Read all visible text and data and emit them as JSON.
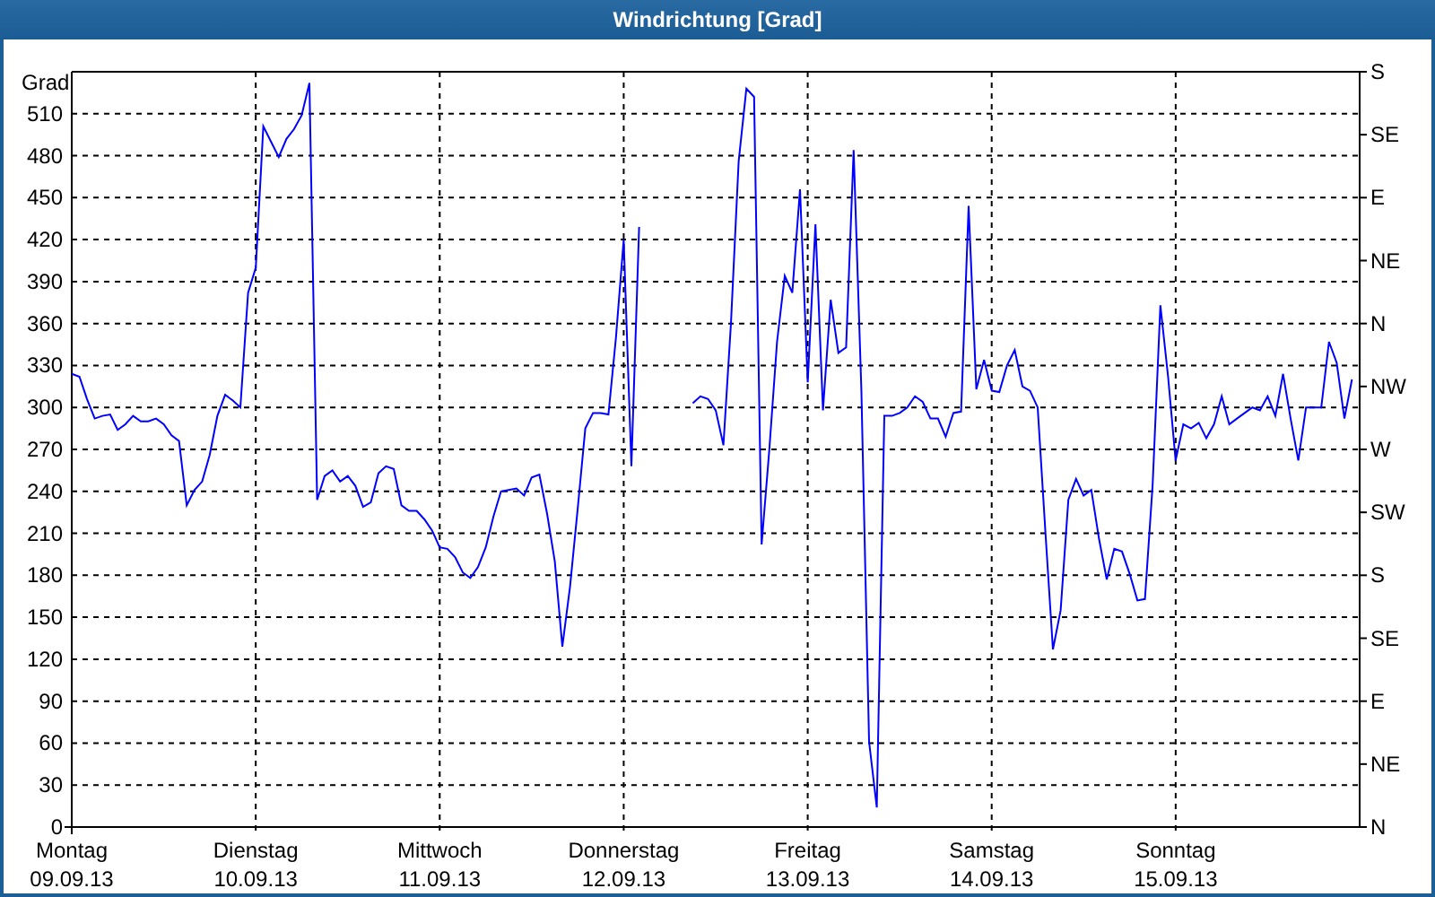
{
  "window": {
    "title": "Windrichtung [Grad]"
  },
  "chart": {
    "chart_data": {
      "type": "line",
      "grid": true,
      "ylabel": "Grad",
      "ylim": [
        0,
        540
      ],
      "yticks": [
        0,
        30,
        60,
        90,
        120,
        150,
        180,
        210,
        240,
        270,
        300,
        330,
        360,
        390,
        420,
        450,
        480,
        510
      ],
      "categories": [
        "09.09.13",
        null,
        null,
        null,
        null,
        null,
        null,
        null,
        null,
        null,
        null,
        null,
        null,
        null,
        null,
        null,
        null,
        null,
        null,
        null,
        null,
        null,
        null,
        null,
        "10.09.13",
        null,
        null,
        null,
        null,
        null,
        null,
        null,
        null,
        null,
        null,
        null,
        null,
        null,
        null,
        null,
        null,
        null,
        null,
        null,
        null,
        null,
        null,
        null,
        "11.09.13",
        null,
        null,
        null,
        null,
        null,
        null,
        null,
        null,
        null,
        null,
        null,
        null,
        null,
        null,
        null,
        null,
        null,
        null,
        null,
        null,
        null,
        null,
        null,
        "12.09.13",
        null,
        null,
        null,
        null,
        null,
        null,
        null,
        null,
        null,
        null,
        null,
        null,
        null,
        null,
        null,
        null,
        null,
        null,
        null,
        null,
        null,
        null,
        null,
        "13.09.13",
        null,
        null,
        null,
        null,
        null,
        null,
        null,
        null,
        null,
        null,
        null,
        null,
        null,
        null,
        null,
        null,
        null,
        null,
        null,
        null,
        null,
        null,
        null,
        "14.09.13",
        null,
        null,
        null,
        null,
        null,
        null,
        null,
        null,
        null,
        null,
        null,
        null,
        null,
        null,
        null,
        null,
        null,
        null,
        null,
        null,
        null,
        null,
        null,
        "15.09.13",
        null,
        null,
        null,
        null,
        null,
        null,
        null,
        null,
        null,
        null,
        null,
        null,
        null,
        null,
        null,
        null,
        null,
        null,
        null,
        null,
        null,
        null,
        null
      ],
      "series": [
        {
          "color": "#0000ff",
          "values": [
            324,
            322,
            306,
            292,
            294,
            295,
            284,
            288,
            294,
            290,
            290,
            292,
            288,
            280,
            276,
            230,
            241,
            247,
            266,
            294,
            309,
            305,
            300,
            382,
            400,
            501,
            490,
            479,
            492,
            499,
            509,
            532,
            234,
            251,
            255,
            247,
            251,
            244,
            229,
            232,
            253,
            258,
            256,
            230,
            226,
            226,
            220,
            212,
            200,
            199,
            193,
            182,
            178,
            186,
            200,
            222,
            240,
            241,
            242,
            237,
            250,
            252,
            224,
            190,
            129,
            172,
            228,
            285,
            296,
            296,
            295,
            350,
            420,
            258,
            429,
            null,
            null,
            null,
            null,
            null,
            null,
            303,
            308,
            306,
            298,
            273,
            360,
            476,
            528,
            522,
            202,
            270,
            347,
            394,
            382,
            456,
            318,
            431,
            298,
            377,
            339,
            343,
            484,
            313,
            61,
            14,
            294,
            294,
            296,
            300,
            308,
            304,
            292,
            292,
            279,
            296,
            297,
            444,
            313,
            334,
            312,
            311,
            330,
            341,
            315,
            312,
            300,
            211,
            127,
            155,
            234,
            249,
            237,
            241,
            206,
            177,
            199,
            197,
            181,
            162,
            163,
            245,
            373,
            322,
            262,
            288,
            285,
            289,
            278,
            288,
            308,
            288,
            292,
            296,
            300,
            298,
            308,
            294,
            324,
            292,
            262,
            300,
            300,
            300,
            347,
            332,
            292,
            320
          ]
        }
      ]
    },
    "weekdays": [
      "Montag",
      "Dienstag",
      "Mittwoch",
      "Donnerstag",
      "Freitag",
      "Samstag",
      "Sonntag"
    ],
    "compass_labels": [
      "S",
      "SE",
      "E",
      "NE",
      "N",
      "NW",
      "W",
      "SW",
      "S",
      "SE",
      "E",
      "NE",
      "N"
    ]
  }
}
